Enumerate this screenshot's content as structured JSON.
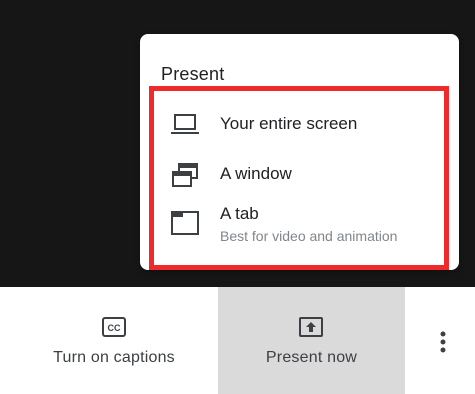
{
  "popup": {
    "title": "Present",
    "options": [
      {
        "label": "Your entire screen",
        "icon": "laptop-icon"
      },
      {
        "label": "A window",
        "icon": "window-icon"
      },
      {
        "label": "A tab",
        "sublabel": "Best for video and animation",
        "icon": "tab-icon"
      }
    ]
  },
  "toolbar": {
    "captions_label": "Turn on captions",
    "captions_icon": "closed-captions-icon",
    "present_label": "Present now",
    "present_icon": "present-screen-icon",
    "more_icon": "more-vert-icon"
  },
  "colors": {
    "background_dark": "#161616",
    "highlight": "#ee2a2a",
    "selected_button": "#dadada",
    "text_primary": "#202124",
    "text_secondary": "#80868b"
  }
}
